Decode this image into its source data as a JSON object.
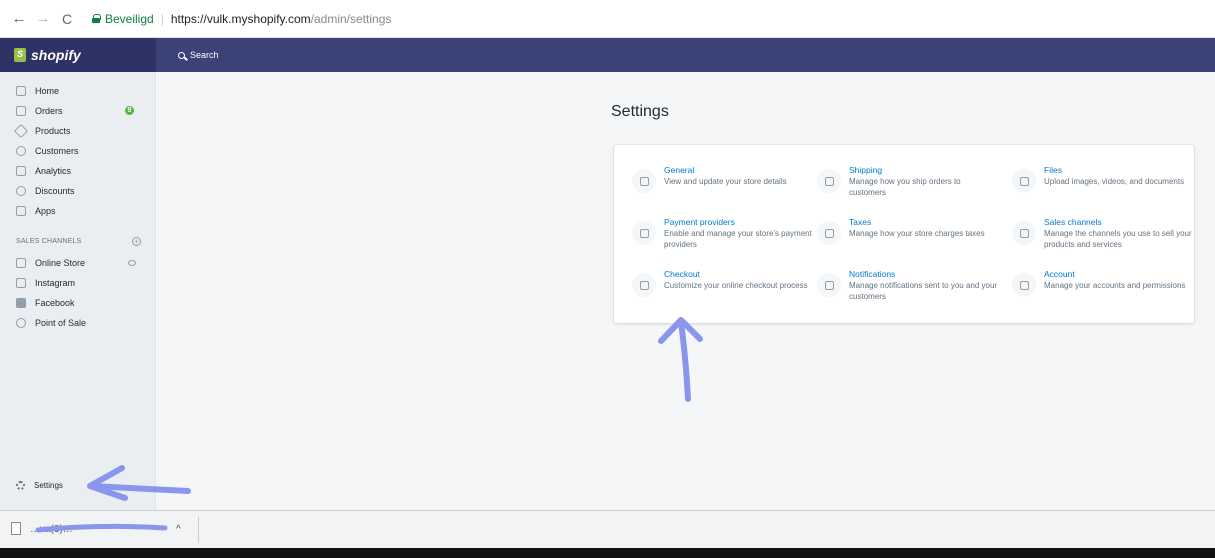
{
  "browser": {
    "secure_label": "Beveiligd",
    "url_host": "https://vulk.myshopify.com",
    "url_path": "/admin/settings"
  },
  "topbar": {
    "brand": "shopify",
    "search_placeholder": "Search"
  },
  "sidebar": {
    "items": [
      {
        "label": "Home",
        "icon": "home-icon"
      },
      {
        "label": "Orders",
        "icon": "orders-icon",
        "badge": "9"
      },
      {
        "label": "Products",
        "icon": "tag-icon"
      },
      {
        "label": "Customers",
        "icon": "person-icon"
      },
      {
        "label": "Analytics",
        "icon": "bar-chart-icon"
      },
      {
        "label": "Discounts",
        "icon": "discount-icon"
      },
      {
        "label": "Apps",
        "icon": "apps-icon"
      }
    ],
    "section_title": "SALES CHANNELS",
    "channels": [
      {
        "label": "Online Store",
        "icon": "store-icon"
      },
      {
        "label": "Instagram",
        "icon": "instagram-icon"
      },
      {
        "label": "Facebook",
        "icon": "facebook-icon"
      },
      {
        "label": "Point of Sale",
        "icon": "location-icon"
      }
    ],
    "settings_label": "Settings"
  },
  "main": {
    "title": "Settings",
    "tiles": [
      {
        "title": "General",
        "desc": "View and update your store details",
        "icon": "gear-icon"
      },
      {
        "title": "Shipping",
        "desc": "Manage how you ship orders to customers",
        "icon": "truck-icon"
      },
      {
        "title": "Files",
        "desc": "Upload images, videos, and documents",
        "icon": "paperclip-icon"
      },
      {
        "title": "Payment providers",
        "desc": "Enable and manage your store's payment providers",
        "icon": "card-icon"
      },
      {
        "title": "Taxes",
        "desc": "Manage how your store charges taxes",
        "icon": "receipt-icon"
      },
      {
        "title": "Sales channels",
        "desc": "Manage the channels you use to sell your products and services",
        "icon": "channels-icon"
      },
      {
        "title": "Checkout",
        "desc": "Customize your online checkout process",
        "icon": "cart-icon"
      },
      {
        "title": "Notifications",
        "desc": "Manage notifications sent to you and your customers",
        "icon": "bell-icon"
      },
      {
        "title": "Account",
        "desc": "Manage your accounts and permissions",
        "icon": "account-icon"
      }
    ]
  },
  "downloads": {
    "file_name": "…va(3)…"
  },
  "colors": {
    "topbar": "#3b4278",
    "brand_bg": "#2d3364",
    "link": "#007ace",
    "annotation": "#8a96ee"
  }
}
